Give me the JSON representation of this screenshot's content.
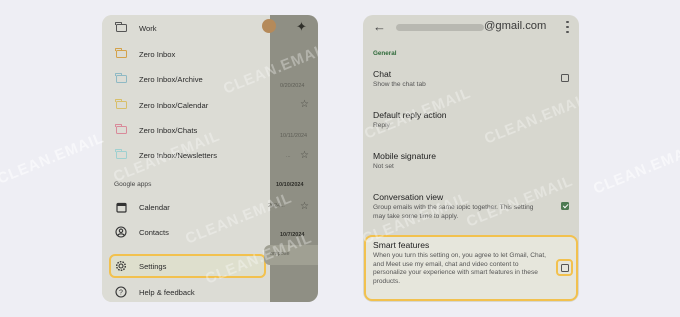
{
  "watermark": "CLEAN.EMAIL",
  "left_phone": {
    "folders": [
      {
        "label": "Work",
        "color": "#555555"
      },
      {
        "label": "Zero Inbox",
        "color": "#d4a24a"
      },
      {
        "label": "Zero Inbox/Archive",
        "color": "#8fb9c4"
      },
      {
        "label": "Zero Inbox/Calendar",
        "color": "#d8bf6a"
      },
      {
        "label": "Zero Inbox/Chats",
        "color": "#d98a9a"
      },
      {
        "label": "Zero Inbox/Newsletters",
        "color": "#9fd0d0"
      }
    ],
    "section_label": "Google apps",
    "apps": {
      "calendar": "Calendar",
      "contacts": "Contacts"
    },
    "settings": "Settings",
    "help": "Help & feedback",
    "behind": {
      "date1": "0/20/2024",
      "date2": "10/11/2024",
      "date3": "10/10/2024",
      "date4": "10/7/2024",
      "snippet": "2024...",
      "ellipsis": "...",
      "compose": "ompose"
    }
  },
  "right_phone": {
    "email_domain": "@gmail.com",
    "section": "General",
    "settings": [
      {
        "title": "Chat",
        "subtitle": "Show the chat tab",
        "checked": false
      },
      {
        "title": "Default reply action",
        "subtitle": "Reply"
      },
      {
        "title": "Mobile signature",
        "subtitle": "Not set"
      },
      {
        "title": "Conversation view",
        "subtitle": "Group emails with the same topic together. This setting may take some time to apply.",
        "checked": true
      },
      {
        "title": "Smart features",
        "subtitle": "When you turn this setting on, you agree to let Gmail, Chat, and Meet use my email, chat and video content to personalize your experience with smart features in these products.",
        "checked": false
      }
    ]
  },
  "colors": {
    "highlight": "#f2c14e",
    "check_green": "#4d7a52"
  }
}
